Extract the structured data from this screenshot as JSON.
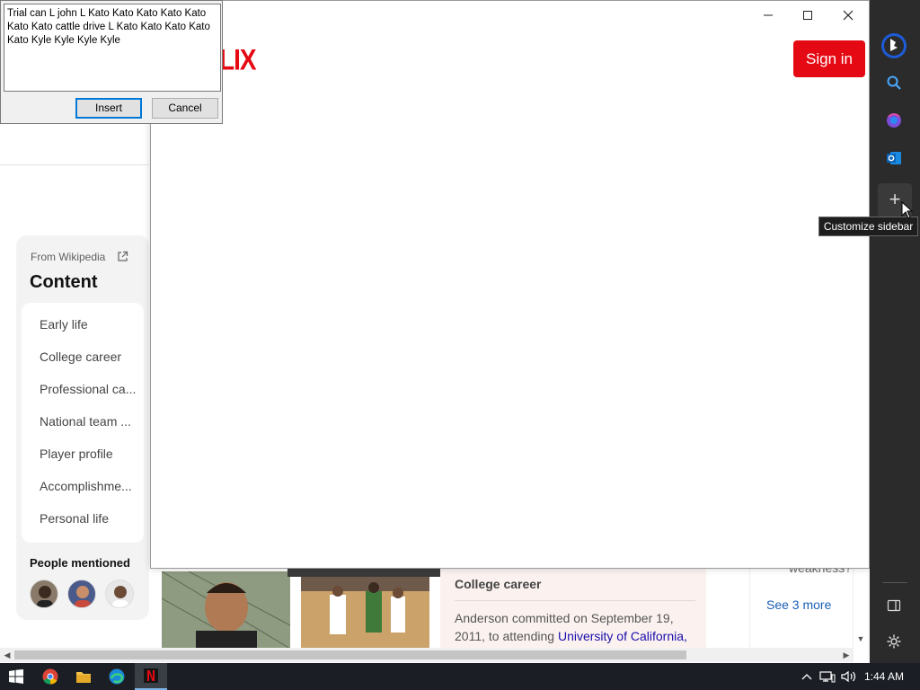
{
  "dialog": {
    "text": "Trial can L john L Kato Kato Kato Kato Kato Kato Kato cattle drive L Kato Kato Kato Kato Kato Kyle Kyle Kyle Kyle",
    "insert_label": "Insert",
    "cancel_label": "Cancel"
  },
  "popup": {
    "brand_partial": "LIX",
    "signin_label": "Sign in",
    "minimize_glyph": "—",
    "maximize_glyph": "☐",
    "close_glyph": "✕",
    "brand_color": "#e50914"
  },
  "wiki": {
    "source": "From Wikipedia",
    "title": "Content",
    "items": [
      "Early life",
      "College career",
      "Professional ca...",
      "National team ...",
      "Player profile",
      "Accomplishme...",
      "Personal life"
    ],
    "people_title": "People mentioned"
  },
  "article": {
    "heading": "College career",
    "text_before_link": "Anderson committed on September 19, 2011, to attending ",
    "link_text": "University of California,",
    "side_faded": "weakness?",
    "see_more": "See 3 more"
  },
  "sidebar": {
    "tooltip": "Customize sidebar",
    "items": [
      "bing-icon",
      "search-icon",
      "copilot-icon",
      "outlook-icon",
      "plus-icon",
      "split-screen-icon",
      "settings-icon"
    ]
  },
  "taskbar": {
    "apps": [
      "windows-start-icon",
      "chrome-icon",
      "file-explorer-icon",
      "edge-icon",
      "netflix-icon"
    ],
    "time": "1:44 AM"
  }
}
